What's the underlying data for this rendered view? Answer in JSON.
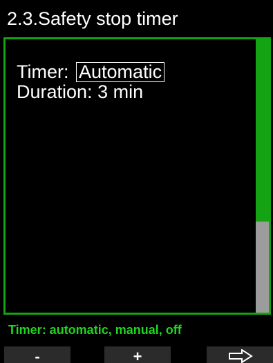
{
  "header": {
    "title": "2.3.Safety stop timer"
  },
  "menu": {
    "timer_label": "Timer:",
    "timer_value": "Automatic",
    "duration_label": "Duration:",
    "duration_value": "3 min"
  },
  "scrollbar": {
    "thumb_fraction": 0.667
  },
  "hint": {
    "text": "Timer: automatic, manual, off"
  },
  "softkeys": {
    "minus_label": "-",
    "plus_label": "+",
    "next_icon": "right-arrow-outline-icon"
  },
  "colors": {
    "accent_green": "#14a312",
    "hint_green": "#1fd61f",
    "scroll_track": "#9c9c9c",
    "softkey_bg": "#2b2b2b",
    "background": "#000000"
  }
}
